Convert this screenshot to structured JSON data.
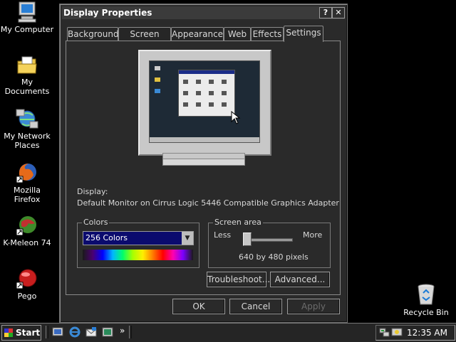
{
  "desktop": {
    "icons": [
      {
        "label_line1": "My Computer",
        "label_line2": "",
        "icon": "computer-icon"
      },
      {
        "label_line1": "My Documents",
        "label_line2": "",
        "icon": "folder-icon"
      },
      {
        "label_line1": "My Network",
        "label_line2": "Places",
        "icon": "network-icon"
      },
      {
        "label_line1": "Mozilla Firefox",
        "label_line2": "",
        "icon": "firefox-icon"
      },
      {
        "label_line1": "K-Meleon 74",
        "label_line2": "",
        "icon": "kmeleon-icon"
      },
      {
        "label_line1": "Pego",
        "label_line2": "",
        "icon": "pego-icon"
      },
      {
        "label_line1": "Recycle Bin",
        "label_line2": "",
        "icon": "recycle-bin-icon"
      }
    ]
  },
  "window": {
    "title": "Display Properties",
    "help_label": "?",
    "close_label": "✕",
    "tabs": [
      "Background",
      "Screen Saver",
      "Appearance",
      "Web",
      "Effects",
      "Settings"
    ],
    "active_tab": "Settings",
    "display_label": "Display:",
    "display_value": "Default Monitor on Cirrus Logic 5446 Compatible Graphics Adapter",
    "colors": {
      "legend": "Colors",
      "selected": "256 Colors",
      "dropdown_arrow": "▼"
    },
    "screen_area": {
      "legend": "Screen area",
      "less": "Less",
      "more": "More",
      "value_text": "640 by 480 pixels",
      "slider_level": 0
    },
    "troubleshoot_label": "Troubleshoot...",
    "advanced_label": "Advanced...",
    "ok_label": "OK",
    "cancel_label": "Cancel",
    "apply_label": "Apply"
  },
  "taskbar": {
    "start_label": "Start",
    "overflow_label": "»",
    "clock": "12:35 AM"
  },
  "colors": {
    "title_bar": "#3b3b3b",
    "select_highlight": "#0b0b6e",
    "desktop": "#000000"
  }
}
